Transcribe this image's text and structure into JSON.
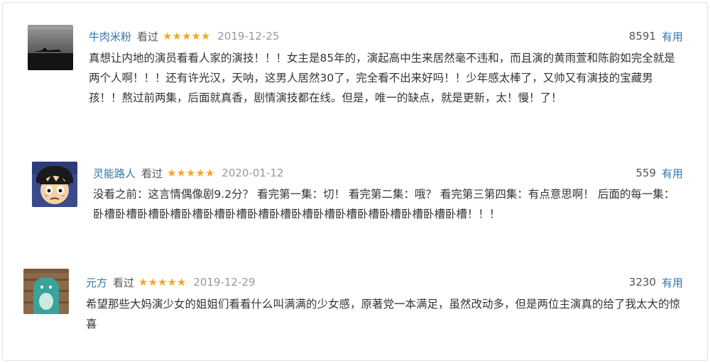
{
  "reviews": [
    {
      "username": "牛肉米粉",
      "watched_label": "看过",
      "rating_stars": 5,
      "date": "2019-12-25",
      "vote_count": "8591",
      "useful_label": "有用",
      "avatar_icon": "dark-landscape-avatar",
      "content": "真想让内地的演员看看人家的演技！！！女主是85年的，演起高中生来居然毫不违和，而且演的黄雨萱和陈韵如完全就是两个人啊！！！还有许光汉，天呐，这男人居然30了，完全看不出来好吗！！少年感太棒了，又帅又有演技的宝藏男孩！！熬过前两集，后面就真香，剧情演技都在线。但是，唯一的缺点，就是更新，太！慢！了！"
    },
    {
      "username": "灵能路人",
      "watched_label": "看过",
      "rating_stars": 5,
      "date": "2020-01-12",
      "vote_count": "559",
      "useful_label": "有用",
      "avatar_icon": "anime-boy-avatar",
      "content": "没看之前：这言情偶像剧9.2分？ 看完第一集：切！ 看完第二集：哦？ 看完第三第四集：有点意思啊！ 后面的每一集：卧槽卧槽卧槽卧槽卧槽卧槽卧槽卧槽卧槽卧槽卧槽卧槽卧槽卧槽卧槽卧槽卧槽！！！"
    },
    {
      "username": "元方",
      "watched_label": "看过",
      "rating_stars": 5,
      "date": "2019-12-29",
      "vote_count": "3230",
      "useful_label": "有用",
      "avatar_icon": "teal-character-avatar",
      "content": "希望那些大妈演少女的姐姐们看看什么叫满满的少女感，原著党一本满足，虽然改动多，但是两位主演真的给了我太大的惊喜"
    }
  ],
  "colors": {
    "link": "#3377aa",
    "star": "#f5a623",
    "date": "#999999"
  }
}
